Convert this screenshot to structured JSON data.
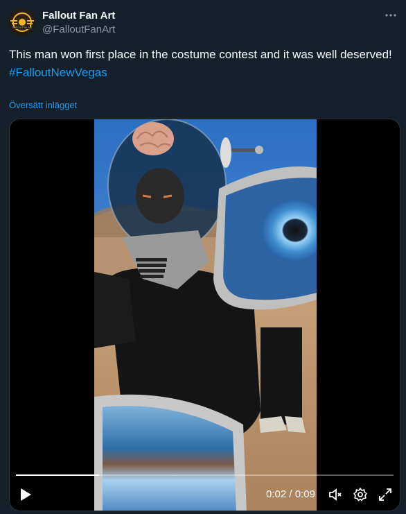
{
  "author": {
    "display_name": "Fallout Fan Art",
    "handle": "@FalloutFanArt",
    "avatar_text": "Fallout Fan Art"
  },
  "tweet": {
    "text": "This man won first place in the costume contest and it was well deserved!",
    "hashtag": "#FalloutNewVegas",
    "translate_label": "Översätt inlägget"
  },
  "video": {
    "current_time": "0:02",
    "separator": "/",
    "duration": "0:09",
    "progress_fraction": 0.22,
    "icons": {
      "play": "play-icon",
      "mute": "volume-muted-icon",
      "settings": "gear-icon",
      "fullscreen": "expand-icon",
      "more": "more-dots-icon"
    }
  },
  "colors": {
    "background": "#15202b",
    "text": "#f7f9f9",
    "secondary_text": "#8b98a5",
    "link": "#1d9bf0"
  }
}
